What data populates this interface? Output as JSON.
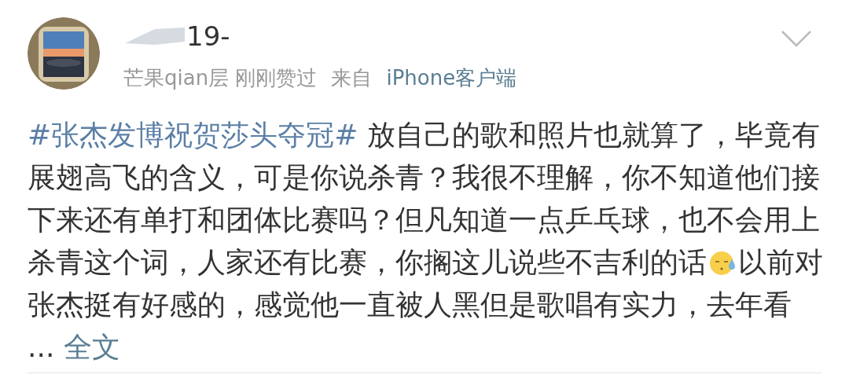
{
  "post": {
    "username": "19-",
    "meta": [
      {
        "kind": "plain",
        "text": "芒果qian层 刚刚赞过"
      },
      {
        "kind": "plain",
        "text": "来自"
      },
      {
        "kind": "link",
        "text": "iPhone客户端"
      }
    ],
    "body": [
      {
        "kind": "hashtag",
        "text": "#张杰发博祝贺莎头夺冠#"
      },
      {
        "kind": "text",
        "text": " 放自己的歌和照片也就算了，毕竟有展翅高飞的含义，可是你说杀青？我很不理解，你不知道他们接下来还有单打和团体比赛吗？但凡知道一点乒乓球，也不会用上杀青这个词，人家还有比赛，你搁这儿说些不吉利的话"
      },
      {
        "kind": "emoji"
      },
      {
        "kind": "text",
        "text": "以前对张杰挺有好感的，感觉他一直被人黑但是歌唱有实力，去年看 ... "
      },
      {
        "kind": "link",
        "text": "全文"
      }
    ]
  }
}
